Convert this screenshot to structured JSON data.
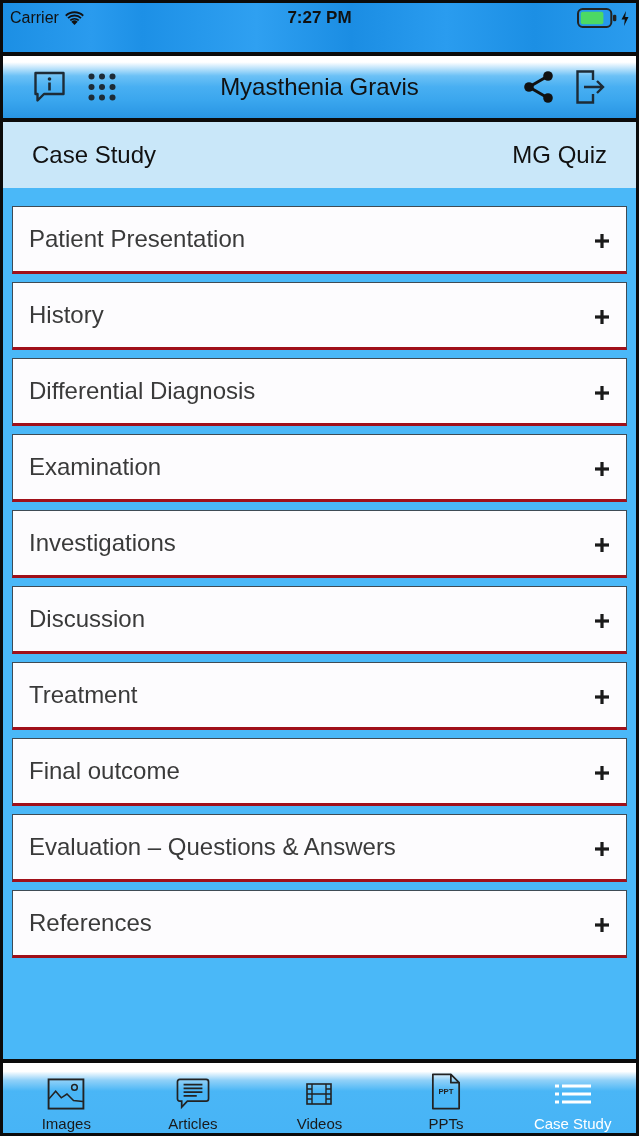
{
  "status_bar": {
    "carrier": "Carrier",
    "time": "7:27 PM"
  },
  "header": {
    "title": "Myasthenia Gravis"
  },
  "segments": [
    {
      "label": "Case Study"
    },
    {
      "label": "MG Quiz"
    }
  ],
  "sections": [
    {
      "title": "Patient Presentation",
      "expanded": false
    },
    {
      "title": "History",
      "expanded": false
    },
    {
      "title": "Differential Diagnosis",
      "expanded": false
    },
    {
      "title": "Examination",
      "expanded": false
    },
    {
      "title": "Investigations",
      "expanded": false
    },
    {
      "title": "Discussion",
      "expanded": false
    },
    {
      "title": "Treatment",
      "expanded": false
    },
    {
      "title": "Final outcome",
      "expanded": false
    },
    {
      "title": "Evaluation – Questions & Answers",
      "expanded": false
    },
    {
      "title": "References",
      "expanded": false
    }
  ],
  "tab_bar": [
    {
      "label": "Images",
      "kind": "images",
      "selected": false
    },
    {
      "label": "Articles",
      "kind": "articles",
      "selected": false
    },
    {
      "label": "Videos",
      "kind": "videos",
      "selected": false
    },
    {
      "label": "PPTs",
      "kind": "ppt",
      "icon_text": "PPT",
      "selected": false
    },
    {
      "label": "Case Study",
      "kind": "list",
      "selected": true
    }
  ]
}
